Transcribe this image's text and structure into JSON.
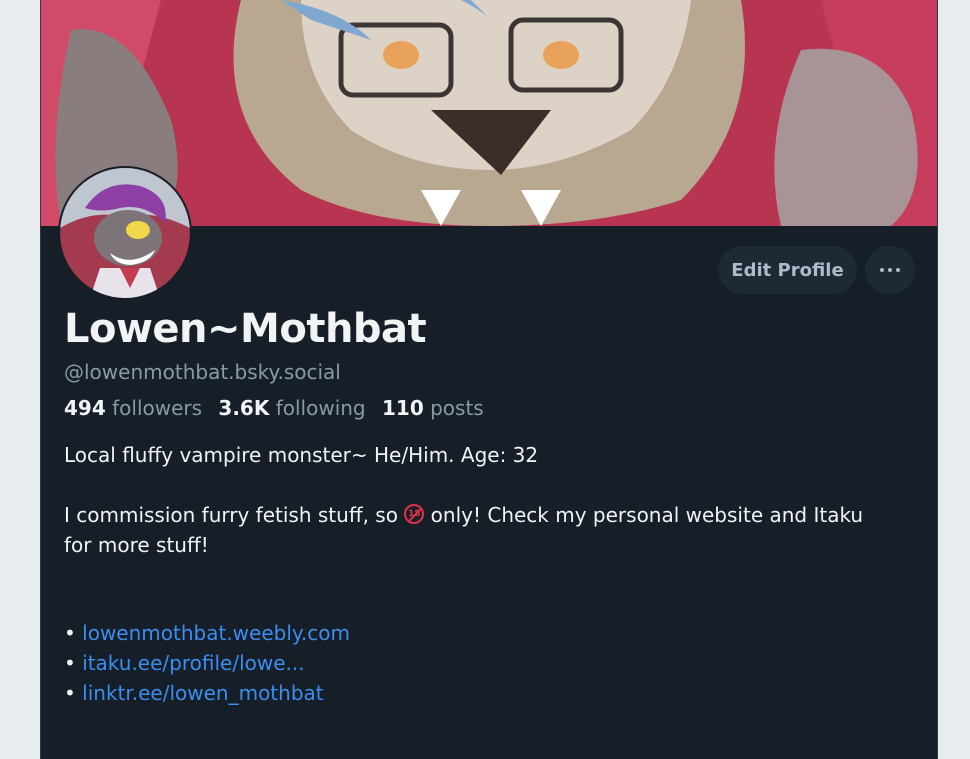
{
  "profile": {
    "display_name": "Lowen~Mothbat",
    "handle": "@lowenmothbat.bsky.social",
    "followers_count": "494",
    "followers_label": "followers",
    "following_count": "3.6K",
    "following_label": "following",
    "posts_count": "110",
    "posts_label": "posts"
  },
  "actions": {
    "edit_profile_label": "Edit Profile",
    "more_icon": "more-horizontal-icon"
  },
  "bio": {
    "line1": "Local fluffy vampire monster~ He/Him. Age: 32",
    "line2_before": "I commission furry fetish stuff, so ",
    "badge_icon": "no-under-18-icon",
    "badge_text": "18",
    "line2_after": " only! Check my personal website and Itaku for more stuff!"
  },
  "links": [
    {
      "bullet": "•",
      "text": "lowenmothbat.weebly.com"
    },
    {
      "bullet": "•",
      "text": "itaku.ee/profile/lowe..."
    },
    {
      "bullet": "•",
      "text": "linktr.ee/lowen_mothbat"
    }
  ],
  "colors": {
    "background": "#161e27",
    "link": "#3b8df0",
    "muted_text": "#8b99a7",
    "button_bg": "#1e2936"
  }
}
